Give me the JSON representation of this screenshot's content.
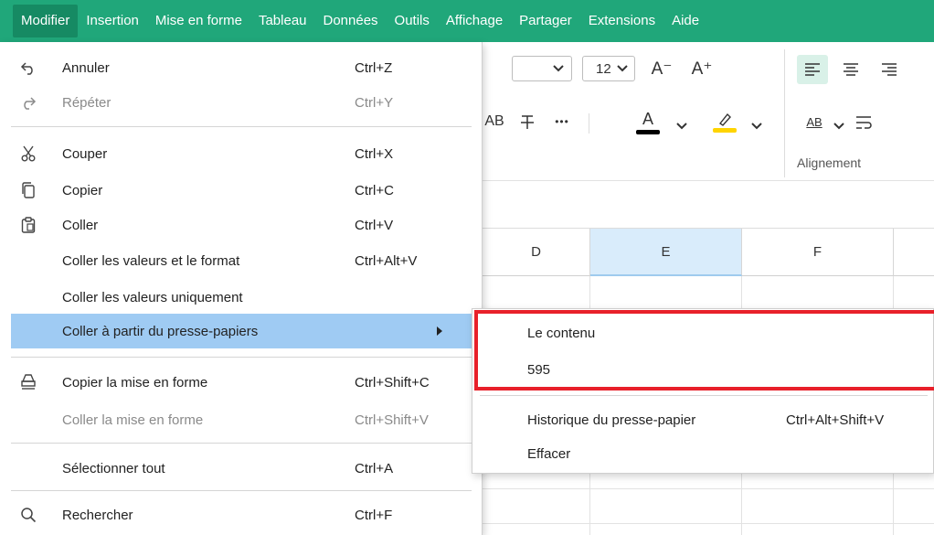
{
  "menubar": {
    "items": [
      "Modifier",
      "Insertion",
      "Mise en forme",
      "Tableau",
      "Données",
      "Outils",
      "Affichage",
      "Partager",
      "Extensions",
      "Aide"
    ],
    "active_index": 0
  },
  "toolbar": {
    "font_size": "12",
    "increase_font_label": "A⁺",
    "decrease_font_label": "A⁻",
    "wrap_text_label": "AB",
    "alignment_group_label": "Alignement",
    "font_color_letter": "A",
    "more_label": "•••",
    "colors": {
      "font_color": "#000000",
      "highlight": "#ffd400",
      "align_active_bg": "#d9f1e8"
    }
  },
  "grid": {
    "columns": [
      "D",
      "E",
      "F"
    ],
    "selected_column": "E"
  },
  "edit_menu": {
    "items": [
      {
        "label": "Annuler",
        "shortcut": "Ctrl+Z",
        "icon": "undo-icon"
      },
      {
        "label": "Répéter",
        "shortcut": "Ctrl+Y",
        "icon": "redo-icon",
        "disabled": true
      },
      {
        "label": "Couper",
        "shortcut": "Ctrl+X",
        "icon": "scissors-icon"
      },
      {
        "label": "Copier",
        "shortcut": "Ctrl+C",
        "icon": "copy-icon"
      },
      {
        "label": "Coller",
        "shortcut": "Ctrl+V",
        "icon": "clipboard-icon"
      },
      {
        "label": "Coller les valeurs et le format",
        "shortcut": "Ctrl+Alt+V"
      },
      {
        "label": "Coller les valeurs uniquement",
        "shortcut": ""
      },
      {
        "label": "Coller à partir du presse-papiers",
        "shortcut": "",
        "submenu": true,
        "highlighted": true
      },
      {
        "label": "Copier la mise en forme",
        "shortcut": "Ctrl+Shift+C",
        "icon": "format-painter-icon"
      },
      {
        "label": "Coller la mise en forme",
        "shortcut": "Ctrl+Shift+V",
        "disabled": true
      },
      {
        "label": "Sélectionner tout",
        "shortcut": "Ctrl+A"
      },
      {
        "label": "Rechercher",
        "shortcut": "Ctrl+F",
        "icon": "search-icon"
      }
    ]
  },
  "clipboard_submenu": {
    "items": [
      {
        "label": "Le contenu",
        "shortcut": ""
      },
      {
        "label": "595",
        "shortcut": ""
      },
      {
        "label": "Historique du presse-papier",
        "shortcut": "Ctrl+Alt+Shift+V"
      },
      {
        "label": "Effacer",
        "shortcut": ""
      }
    ],
    "highlight_color": "#e8202a"
  }
}
